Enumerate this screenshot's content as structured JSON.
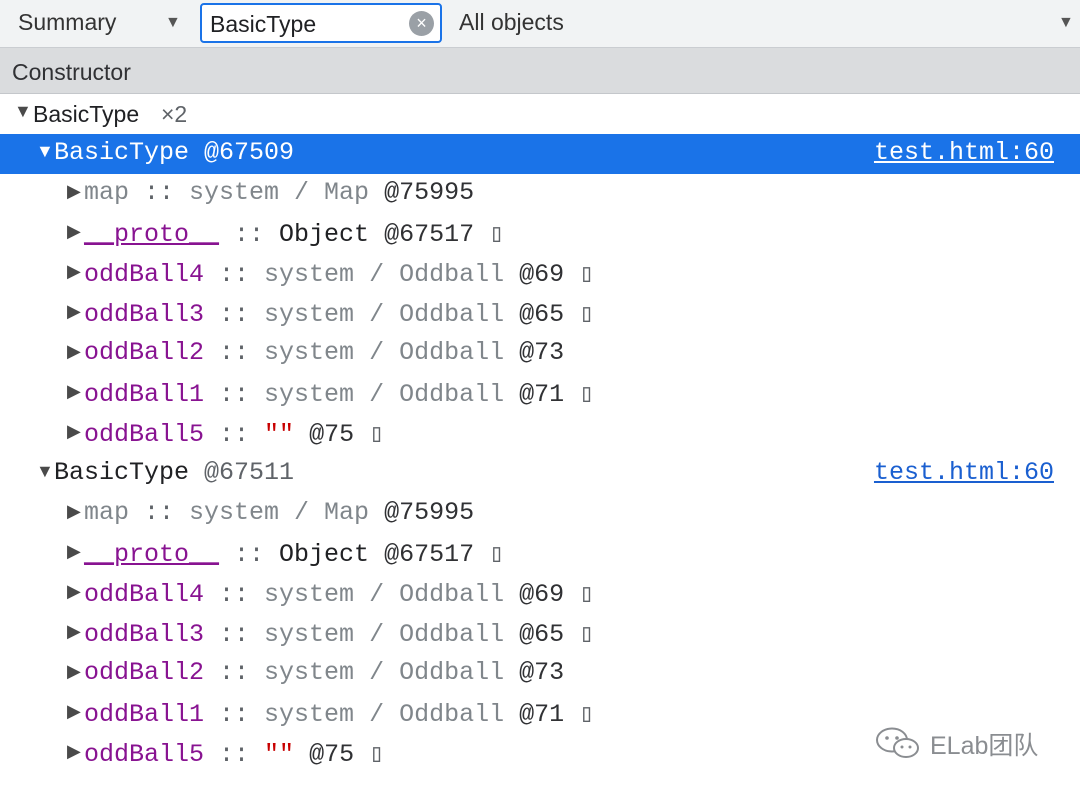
{
  "toolbar": {
    "view_select": "Summary",
    "filter_value": "BasicType",
    "objects_select": "All objects"
  },
  "table": {
    "header": "Constructor"
  },
  "group": {
    "name": "BasicType",
    "count": "×2"
  },
  "instances": [
    {
      "name": "BasicType",
      "id": "@67509",
      "source": "test.html:60",
      "props": [
        {
          "name": "map",
          "sep": " :: ",
          "type": "system / Map",
          "id": " @75995",
          "box": ""
        },
        {
          "name": "__proto__",
          "sep": " :: ",
          "type": "Object",
          "id": " @67517",
          "box": " ▯"
        },
        {
          "name": "oddBall4",
          "sep": " :: ",
          "type": "system / Oddball",
          "id": " @69",
          "box": " ▯"
        },
        {
          "name": "oddBall3",
          "sep": " :: ",
          "type": "system / Oddball",
          "id": " @65",
          "box": " ▯"
        },
        {
          "name": "oddBall2",
          "sep": " :: ",
          "type": "system / Oddball",
          "id": " @73",
          "box": ""
        },
        {
          "name": "oddBall1",
          "sep": " :: ",
          "type": "system / Oddball",
          "id": " @71",
          "box": " ▯"
        },
        {
          "name": "oddBall5",
          "sep": " :: ",
          "type": "\"\"",
          "id": " @75",
          "box": " ▯"
        }
      ]
    },
    {
      "name": "BasicType",
      "id": "@67511",
      "source": "test.html:60",
      "props": [
        {
          "name": "map",
          "sep": " :: ",
          "type": "system / Map",
          "id": " @75995",
          "box": ""
        },
        {
          "name": "__proto__",
          "sep": " :: ",
          "type": "Object",
          "id": " @67517",
          "box": " ▯"
        },
        {
          "name": "oddBall4",
          "sep": " :: ",
          "type": "system / Oddball",
          "id": " @69",
          "box": " ▯"
        },
        {
          "name": "oddBall3",
          "sep": " :: ",
          "type": "system / Oddball",
          "id": " @65",
          "box": " ▯"
        },
        {
          "name": "oddBall2",
          "sep": " :: ",
          "type": "system / Oddball",
          "id": " @73",
          "box": ""
        },
        {
          "name": "oddBall1",
          "sep": " :: ",
          "type": "system / Oddball",
          "id": " @71",
          "box": " ▯"
        },
        {
          "name": "oddBall5",
          "sep": " :: ",
          "type": "\"\"",
          "id": " @75",
          "box": " ▯"
        }
      ]
    }
  ],
  "watermark": {
    "text": "ELab团队",
    "icon": "wechat-icon"
  },
  "colors": {
    "selection": "#1a73e8",
    "property_name": "#881391",
    "string_value": "#c80000",
    "link": "#1a5fd0"
  }
}
